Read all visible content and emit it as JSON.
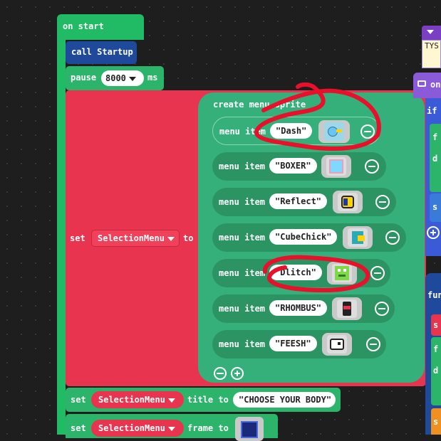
{
  "on_start": {
    "label": "on start"
  },
  "call_block": {
    "label": "call Startup"
  },
  "pause_block": {
    "label": "pause",
    "value": "8000",
    "unit": "ms"
  },
  "set_menu_block": {
    "set_label": "set",
    "variable": "SelectionMenu",
    "to_label": "to"
  },
  "create_menu": {
    "label": "create menu sprite",
    "items": [
      {
        "item_label": "menu item",
        "name": "Dash",
        "sprite": "dash-sprite"
      },
      {
        "item_label": "menu item",
        "name": "BOXER",
        "sprite": "boxer-sprite"
      },
      {
        "item_label": "menu item",
        "name": "Reflect",
        "sprite": "reflect-sprite"
      },
      {
        "item_label": "menu item",
        "name": "CubeChick",
        "sprite": "cubechick-sprite"
      },
      {
        "item_label": "menu item",
        "name": "Dlitch",
        "sprite": "dlitch-sprite"
      },
      {
        "item_label": "menu item",
        "name": "RHOMBUS",
        "sprite": "rhombus-sprite"
      },
      {
        "item_label": "menu item",
        "name": "FEESH",
        "sprite": "feesh-sprite"
      }
    ]
  },
  "set_title_block": {
    "set_label": "set",
    "variable": "SelectionMenu",
    "prop": "title to",
    "value": "CHOOSE YOUR BODY"
  },
  "set_frame_block": {
    "set_label": "set",
    "variable": "SelectionMenu",
    "prop": "frame to"
  },
  "right_partial": {
    "typ_text": "TYS",
    "on_text": "on",
    "if_text": "if",
    "f1": "f",
    "d1": "d",
    "s1": "s",
    "fun_text": "fun",
    "s2": "s",
    "f2": "f",
    "d2": "d",
    "s3": "s"
  },
  "colors": {
    "event_green": "#21ba65",
    "call_blue": "#1f4a9c",
    "loop_green": "#2cb56a",
    "sprite_red": "#e8344e",
    "menu_green": "#36b07a",
    "annotation_red": "#e8102a"
  }
}
